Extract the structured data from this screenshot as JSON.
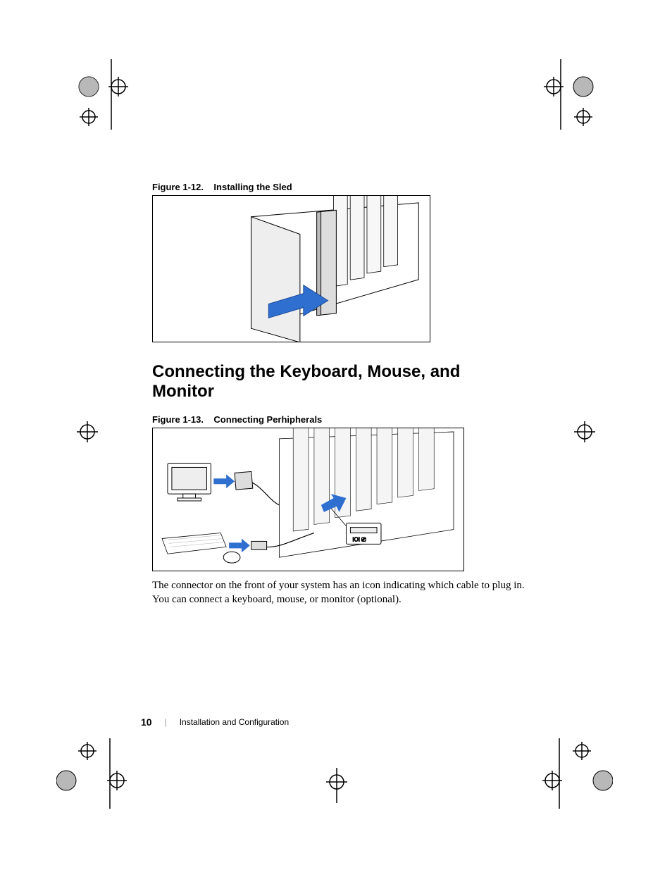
{
  "figure_1_12": {
    "label": "Figure 1-12.",
    "title": "Installing the Sled"
  },
  "section_heading": "Connecting the Keyboard, Mouse, and Monitor",
  "figure_1_13": {
    "label": "Figure 1-13.",
    "title": "Connecting Perhipherals"
  },
  "body_paragraph": "The connector on the front of your system has an icon indicating which cable to plug in. You can connect a keyboard, mouse, or monitor (optional).",
  "footer": {
    "page_number": "10",
    "section_title": "Installation and Configuration"
  }
}
